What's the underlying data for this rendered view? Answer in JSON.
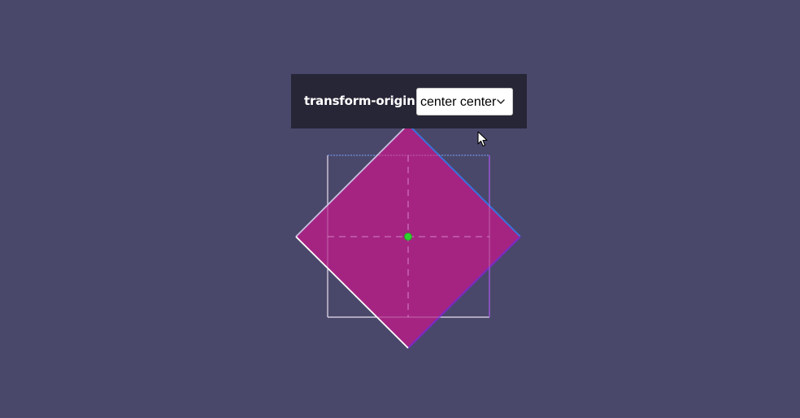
{
  "control": {
    "label": "transform-origin:",
    "select_value": "center center"
  },
  "colors": {
    "background": "#4a486a",
    "panel": "#262636",
    "shape_fill": "#a82383",
    "origin_dot": "#2ed12e",
    "edge_top_right": "#3a73df",
    "edge_bottom_right": "#7b2ac4",
    "edge_white": "#ffffff"
  },
  "icons": {
    "select_arrow": "chevron-down-icon",
    "pointer": "cursor-arrow-icon",
    "origin": "origin-dot-icon"
  }
}
